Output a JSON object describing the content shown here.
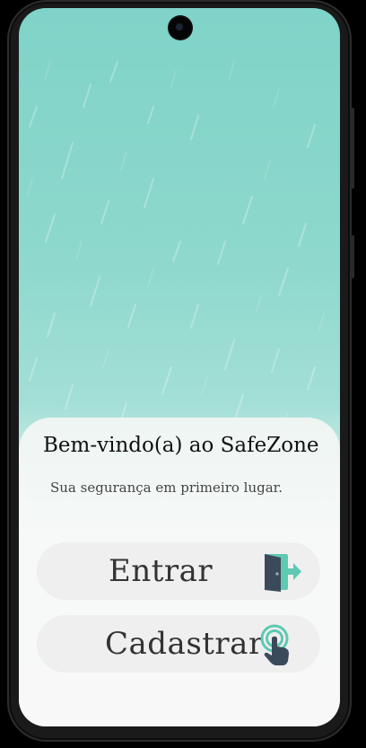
{
  "welcome": {
    "title": "Bem-vindo(a) ao SafeZone",
    "subtitle": "Sua segurança em primeiro lugar."
  },
  "actions": {
    "login_label": "Entrar",
    "register_label": "Cadastrar"
  },
  "icons": {
    "login": "door-exit-icon",
    "register": "tap-finger-icon"
  },
  "colors": {
    "background": "#8ed8cd",
    "accent": "#5fc9b3",
    "button": "#efefef",
    "icon_dark": "#3b4a5a"
  }
}
